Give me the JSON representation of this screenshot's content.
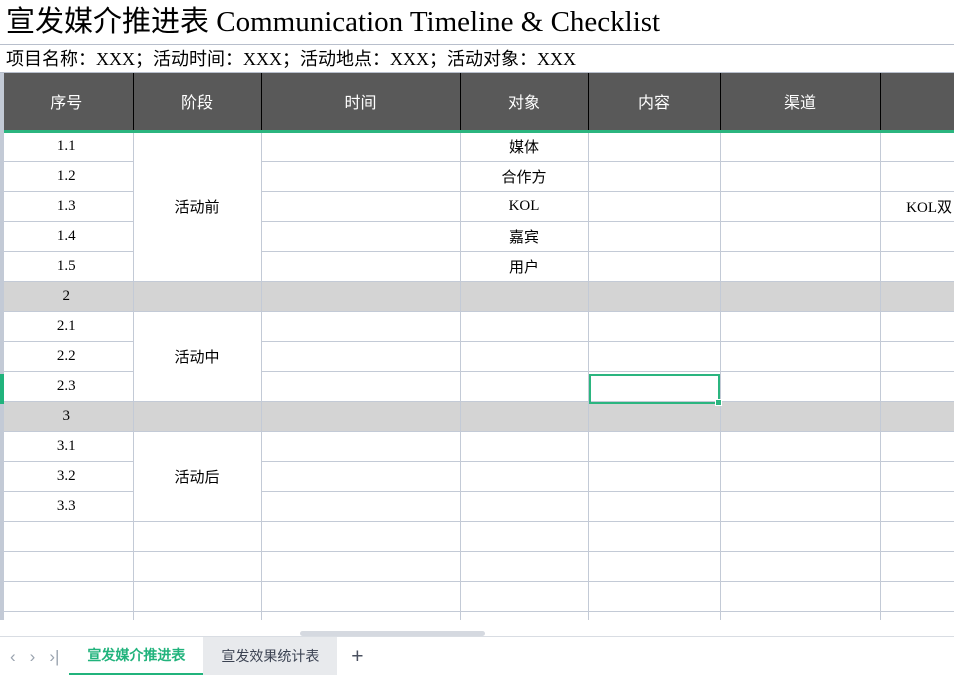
{
  "document": {
    "title_cell": "宣发媒介推进表 Communication Timeline & Checklist",
    "subtitle_cell": "项目名称：XXX；活动时间：XXX；活动地点：XXX；活动对象：XXX"
  },
  "table": {
    "headers": [
      "序号",
      "阶段",
      "时间",
      "对象",
      "内容",
      "渠道",
      ""
    ],
    "rows": [
      {
        "id": "1.1",
        "stage": "活动前",
        "time": "",
        "object": "媒体",
        "content": "",
        "channel": "",
        "extra": "",
        "shaded": false
      },
      {
        "id": "1.2",
        "stage": "",
        "time": "",
        "object": "合作方",
        "content": "",
        "channel": "",
        "extra": "",
        "shaded": false
      },
      {
        "id": "1.3",
        "stage": "",
        "time": "",
        "object": "KOL",
        "content": "",
        "channel": "",
        "extra": "KOL双",
        "shaded": false
      },
      {
        "id": "1.4",
        "stage": "",
        "time": "",
        "object": "嘉宾",
        "content": "",
        "channel": "",
        "extra": "",
        "shaded": false
      },
      {
        "id": "1.5",
        "stage": "",
        "time": "",
        "object": "用户",
        "content": "",
        "channel": "",
        "extra": "",
        "shaded": false
      },
      {
        "id": "2",
        "stage": "",
        "time": "",
        "object": "",
        "content": "",
        "channel": "",
        "extra": "",
        "shaded": true
      },
      {
        "id": "2.1",
        "stage": "活动中",
        "time": "",
        "object": "",
        "content": "",
        "channel": "",
        "extra": "",
        "shaded": false
      },
      {
        "id": "2.2",
        "stage": "",
        "time": "",
        "object": "",
        "content": "",
        "channel": "",
        "extra": "",
        "shaded": false
      },
      {
        "id": "2.3",
        "stage": "",
        "time": "",
        "object": "",
        "content": "",
        "channel": "",
        "extra": "",
        "shaded": false
      },
      {
        "id": "3",
        "stage": "",
        "time": "",
        "object": "",
        "content": "",
        "channel": "",
        "extra": "",
        "shaded": true
      },
      {
        "id": "3.1",
        "stage": "活动后",
        "time": "",
        "object": "",
        "content": "",
        "channel": "",
        "extra": "",
        "shaded": false
      },
      {
        "id": "3.2",
        "stage": "",
        "time": "",
        "object": "",
        "content": "",
        "channel": "",
        "extra": "",
        "shaded": false
      },
      {
        "id": "3.3",
        "stage": "",
        "time": "",
        "object": "",
        "content": "",
        "channel": "",
        "extra": "",
        "shaded": false
      }
    ],
    "merged_stages": [
      {
        "label": "活动前",
        "span": 5
      },
      {
        "label": "活动中",
        "span": 3
      },
      {
        "label": "活动后",
        "span": 3
      }
    ],
    "empty_trailing_rows": 4,
    "selected_cell": {
      "column": "内容",
      "row": "2.3"
    }
  },
  "tabbar": {
    "nav": {
      "prev_icon": "‹",
      "next_icon": "›",
      "last_icon": "›|"
    },
    "sheets": [
      {
        "name": "宣发媒介推进表",
        "active": true
      },
      {
        "name": "宣发效果统计表",
        "active": false
      }
    ],
    "add_label": "+"
  },
  "colors": {
    "header_bg": "#595959",
    "accent_green": "#21b37c",
    "shade_row": "#d4d4d4",
    "gridline": "#c3cad6"
  }
}
